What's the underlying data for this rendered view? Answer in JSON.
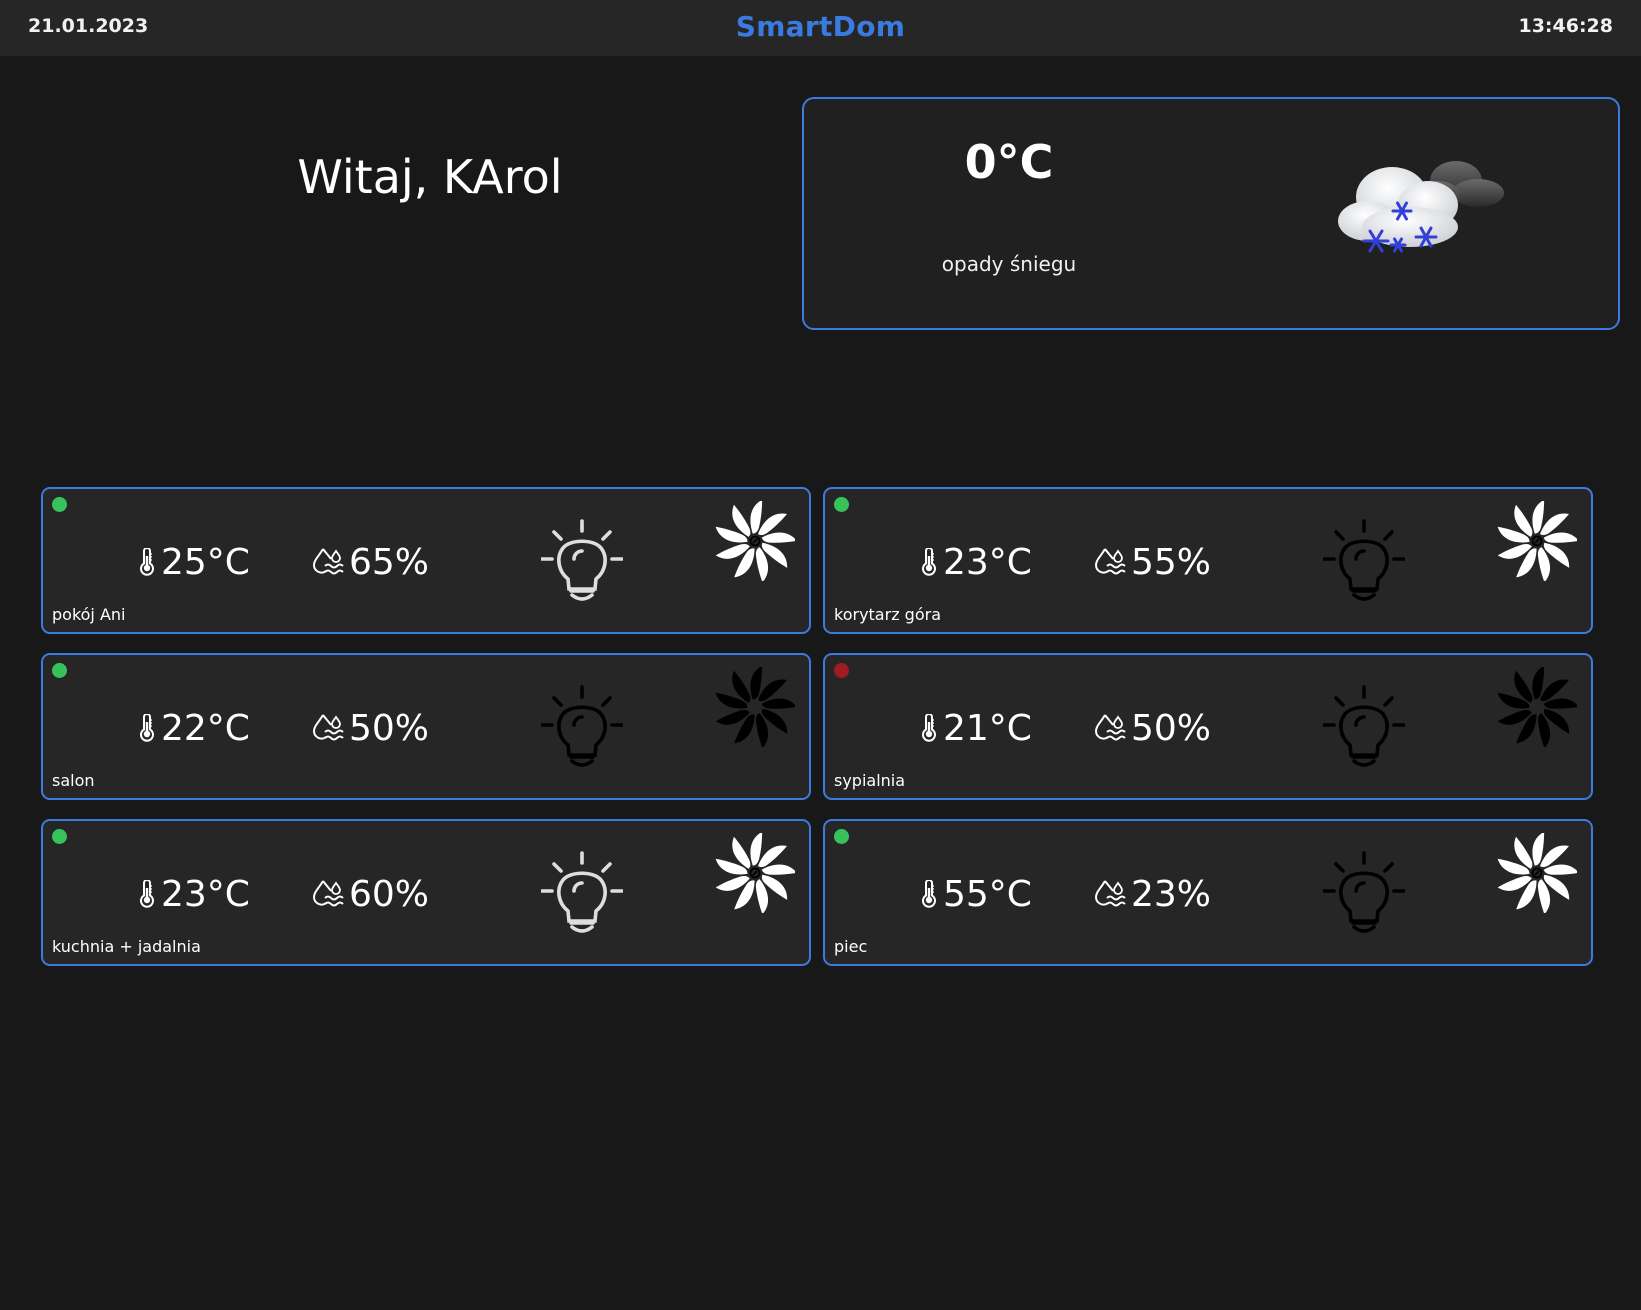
{
  "header": {
    "date": "21.01.2023",
    "brand": "SmartDom",
    "time": "13:46:28"
  },
  "greeting": "Witaj, KArol",
  "weather": {
    "temperature": "0°C",
    "description": "opady śniegu",
    "icon": "snow-cloud-icon"
  },
  "colors": {
    "accent": "#3b7be0",
    "background": "#181818",
    "card": "#262626",
    "status_ok": "#37c35a",
    "status_error": "#9e1c22",
    "device_on": "#ffffff",
    "device_off": "#000000"
  },
  "rooms": [
    {
      "name": "pokój Ani",
      "temperature": "25°C",
      "humidity": "65%",
      "status": "ok",
      "light_on": true,
      "fan_on": true
    },
    {
      "name": "korytarz góra",
      "temperature": "23°C",
      "humidity": "55%",
      "status": "ok",
      "light_on": false,
      "fan_on": true
    },
    {
      "name": "salon",
      "temperature": "22°C",
      "humidity": "50%",
      "status": "ok",
      "light_on": false,
      "fan_on": false
    },
    {
      "name": "sypialnia",
      "temperature": "21°C",
      "humidity": "50%",
      "status": "error",
      "light_on": false,
      "fan_on": false
    },
    {
      "name": "kuchnia + jadalnia",
      "temperature": "23°C",
      "humidity": "60%",
      "status": "ok",
      "light_on": true,
      "fan_on": true
    },
    {
      "name": "piec",
      "temperature": "55°C",
      "humidity": "23%",
      "status": "ok",
      "light_on": false,
      "fan_on": true
    }
  ]
}
